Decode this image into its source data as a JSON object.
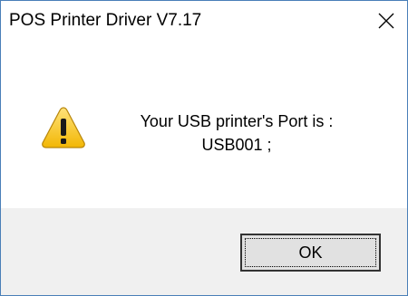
{
  "window": {
    "title": "POS Printer Driver V7.17",
    "close_icon": "close-icon"
  },
  "message": {
    "icon": "warning-icon",
    "line1": "Your USB printer's Port is :",
    "line2": "USB001 ;"
  },
  "buttons": {
    "ok_label": "OK"
  },
  "colors": {
    "window_border": "#4a7fb8",
    "footer_bg": "#f0f0f0",
    "warning_fill": "#f5c518"
  }
}
